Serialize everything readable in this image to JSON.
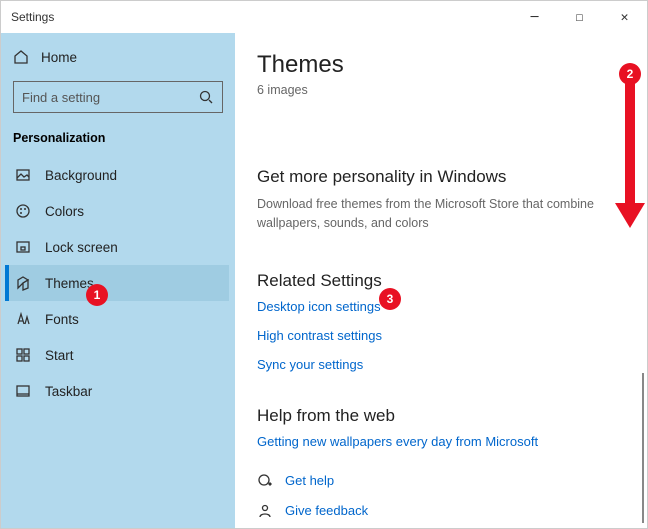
{
  "window": {
    "title": "Settings"
  },
  "sidebar": {
    "home": "Home",
    "search_placeholder": "Find a setting",
    "section": "Personalization",
    "items": [
      {
        "label": "Background"
      },
      {
        "label": "Colors"
      },
      {
        "label": "Lock screen"
      },
      {
        "label": "Themes"
      },
      {
        "label": "Fonts"
      },
      {
        "label": "Start"
      },
      {
        "label": "Taskbar"
      }
    ]
  },
  "content": {
    "title": "Themes",
    "subcount": "6 images",
    "more_h": "Get more personality in Windows",
    "more_d": "Download free themes from the Microsoft Store that combine wallpapers, sounds, and colors",
    "related_h": "Related Settings",
    "links": {
      "desktop": "Desktop icon settings",
      "highcontrast": "High contrast settings",
      "sync": "Sync your settings"
    },
    "help_h": "Help from the web",
    "help_link": "Getting new wallpapers every day from Microsoft",
    "gethelp": "Get help",
    "feedback": "Give feedback"
  },
  "annotations": {
    "b1": "1",
    "b2": "2",
    "b3": "3"
  }
}
